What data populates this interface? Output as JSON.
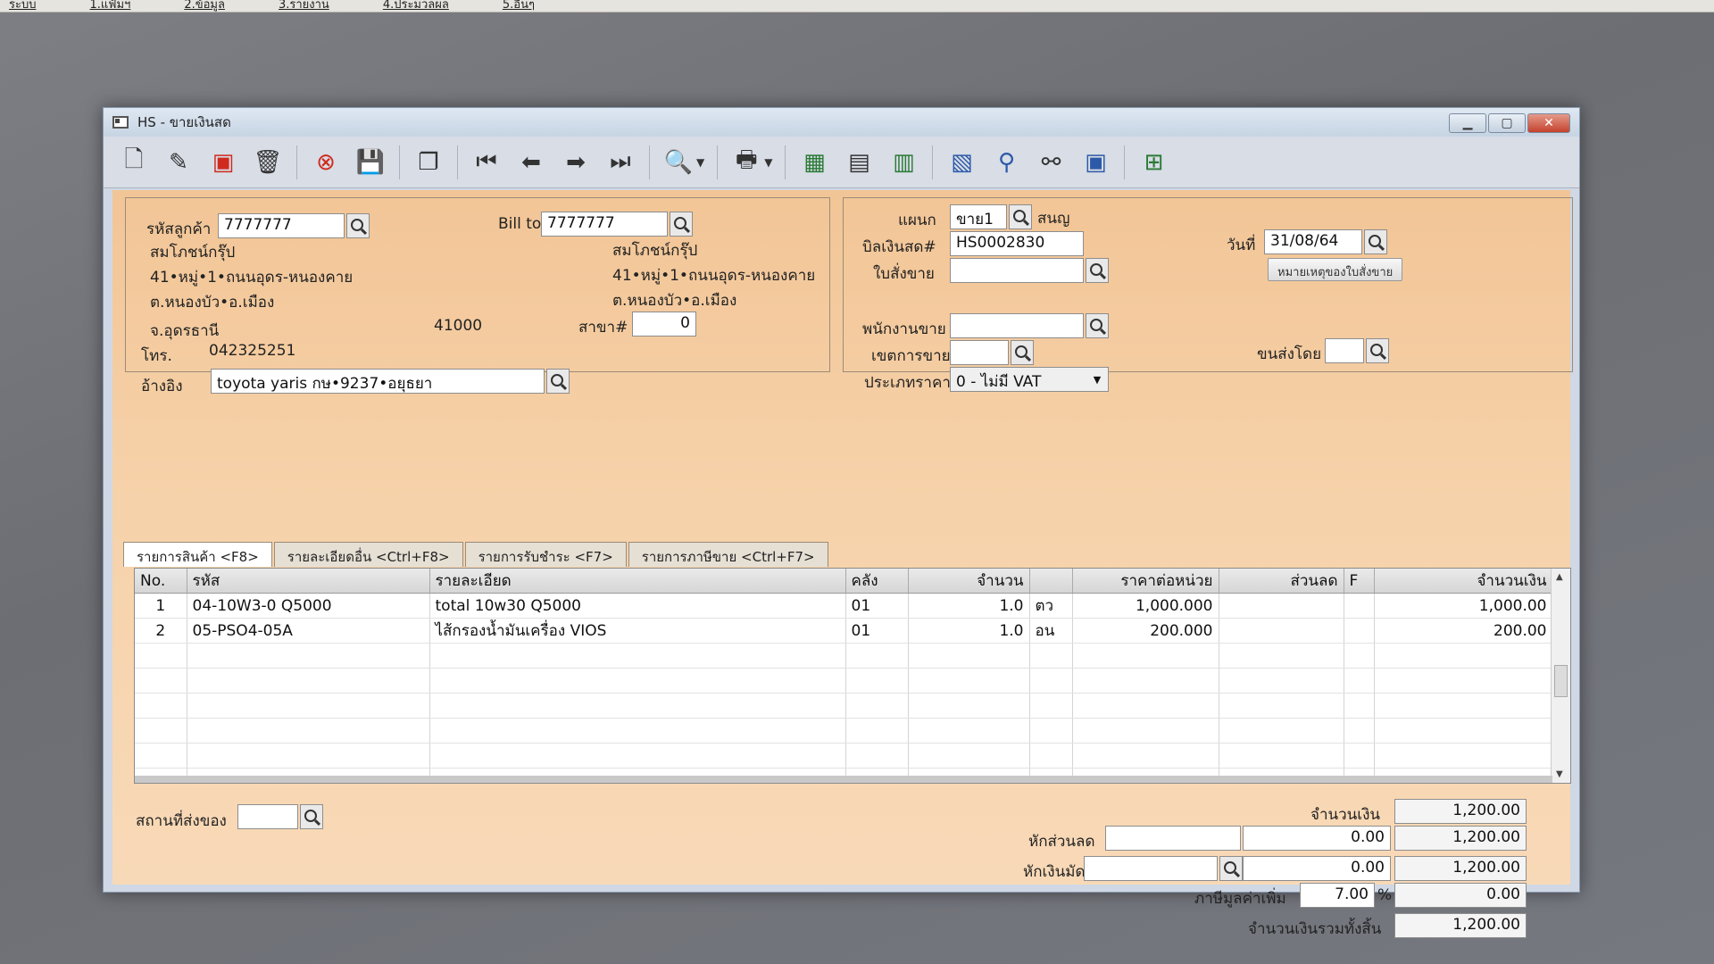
{
  "menu": [
    "ระบบ",
    "1.แฟ้มฯ",
    "2.ข้อมูล",
    "3.รายงาน",
    "4.ประมวลผล",
    "5.อื่นๆ"
  ],
  "window": {
    "title": "HS - ขายเงินสด"
  },
  "customer": {
    "code_label": "รหัสลูกค้า",
    "code": "7777777",
    "name": "สมโภชน์กรุ๊ป",
    "addr1": "41•หมู่•1•ถนนอุดร-หนองคาย",
    "addr2": "ต.หนองบัว•อ.เมือง",
    "province": "จ.อุดรธานี",
    "zip": "41000",
    "phone_label": "โทร.",
    "phone": "042325251",
    "ref_label": "อ้างอิง",
    "ref": "toyota yaris กษ•9237•อยุธยา"
  },
  "billto": {
    "label": "Bill to",
    "code": "7777777",
    "name": "สมโภชน์กรุ๊ป",
    "addr1": "41•หมู่•1•ถนนอุดร-หนองคาย",
    "addr2": "ต.หนองบัว•อ.เมือง",
    "branch_label": "สาขา#",
    "branch": "0"
  },
  "doc": {
    "dept_label": "แผนก",
    "dept": "ขาย1",
    "dept_name": "สนญ",
    "bill_label": "บิลเงินสด#",
    "bill": "HS0002830",
    "so_label": "ใบสั่งขาย",
    "so": "",
    "date_label": "วันที่",
    "date": "31/08/64",
    "note_button": "หมายเหตุของใบสั่งขาย",
    "salesman_label": "พนักงานขาย",
    "salesman": "",
    "area_label": "เขตการขาย",
    "area": "",
    "ship_by_label": "ขนส่งโดย",
    "ship_by": "",
    "price_type_label": "ประเภทราคา",
    "price_type": "0 - ไม่มี VAT"
  },
  "tabs": [
    "รายการสินค้า <F8>",
    "รายละเอียดอื่น <Ctrl+F8>",
    "รายการรับชำระ <F7>",
    "รายการภาษีขาย <Ctrl+F7>"
  ],
  "grid": {
    "columns": [
      "No.",
      "รหัส",
      "รายละเอียด",
      "คลัง",
      "จำนวน",
      "",
      "ราคาต่อหน่วย",
      "ส่วนลด",
      "F",
      "จำนวนเงิน"
    ],
    "rows": [
      [
        "1",
        "04-10W3-0 Q5000",
        "total 10w30 Q5000",
        "01",
        "1.0",
        "ตว",
        "1,000.000",
        "",
        "",
        "1,000.00"
      ],
      [
        "2",
        "05-PSO4-05A",
        "ไส้กรองน้ำมันเครื่อง VIOS",
        "01",
        "1.0",
        "อน",
        "200.000",
        "",
        "",
        "200.00"
      ]
    ]
  },
  "footer": {
    "ship_place_label": "สถานที่ส่งของ",
    "ship_place": "",
    "amount_label": "จำนวนเงิน",
    "amount": "1,200.00",
    "discount_label": "หักส่วนลด",
    "discount_text": "",
    "discount": "0.00",
    "after_discount": "1,200.00",
    "deposit_label": "หักเงินมัดจำ",
    "deposit_text": "",
    "deposit": "0.00",
    "after_deposit": "1,200.00",
    "vat_label": "ภาษีมูลค่าเพิ่ม",
    "vat_rate": "7.00",
    "vat_pct": "%",
    "vat": "0.00",
    "total_label": "จำนวนเงินรวมทั้งสิ้น",
    "total": "1,200.00"
  }
}
